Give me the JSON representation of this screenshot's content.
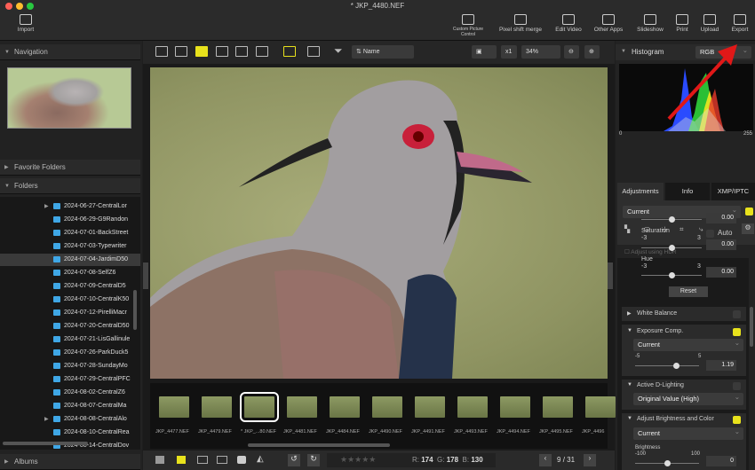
{
  "window": {
    "title": "* JKP_4480.NEF"
  },
  "toolbar": {
    "import": "Import",
    "custom_picture_control": "Custom Picture Control",
    "pixel_shift_merge": "Pixel shift merge",
    "edit_video": "Edit Video",
    "other_apps": "Other Apps",
    "slideshow": "Slideshow",
    "print": "Print",
    "upload": "Upload",
    "export": "Export"
  },
  "left": {
    "navigation": "Navigation",
    "favorite_folders": "Favorite Folders",
    "folders": "Folders",
    "albums": "Albums",
    "folder_items": [
      "2024-06-27-CentralLor",
      "2024-06-29-G9Randon",
      "2024-07-01-BackStreet",
      "2024-07-03-Typewriter",
      "2024-07-04-JardimD50",
      "2024-07-08-SelfZ6",
      "2024-07-09-CentralD5",
      "2024-07-10-CentralK50",
      "2024-07-12-PirelliMacr",
      "2024-07-20-CentralD50",
      "2024-07-21-LisGallinule",
      "2024-07-26-ParkDuck5",
      "2024-07-28-SundayMo",
      "2024-07-29-CentralPFC",
      "2024-08-02-CentralZ6",
      "2024-08-07-CentralMa",
      "2024-08-08-CentralAlo",
      "2024-08-10-CentralRea",
      "2024-08-14-CentralDov"
    ]
  },
  "viewer": {
    "sort": "Name",
    "magnification": "x1",
    "zoom": "34%"
  },
  "filmstrip": [
    "JKP_4477.NEF",
    "JKP_4479.NEF",
    "* JKP_...80.NEF",
    "JKP_4481.NEF",
    "JKP_4484.NEF",
    "JKP_4490.NEF",
    "JKP_4491.NEF",
    "JKP_4493.NEF",
    "JKP_4494.NEF",
    "JKP_4495.NEF",
    "JKP_4496"
  ],
  "statusbar": {
    "r_label": "R:",
    "r": "174",
    "g_label": "G:",
    "g": "178",
    "b_label": "B:",
    "b": "130",
    "page": "9",
    "sep": "/",
    "total": "31"
  },
  "right": {
    "histogram": "Histogram",
    "channel": "RGB",
    "hist_min": "0",
    "hist_max": "255",
    "tabs": [
      "Adjustments",
      "Info",
      "XMP/IPTC"
    ],
    "preset": "Current",
    "hdr": "Adjust using HDR",
    "top_value": "0.00",
    "saturation": "Saturation",
    "sat_min": "-3",
    "sat_max": "3",
    "sat_value": "0.00",
    "auto": "Auto",
    "hue": "Hue",
    "hue_min": "-3",
    "hue_max": "3",
    "hue_value": "0.00",
    "reset": "Reset",
    "white_balance": "White Balance",
    "exposure": "Exposure Comp.",
    "exposure_preset": "Current",
    "exp_min": "-5",
    "exp_max": "5",
    "exp_value": "1.19",
    "adl": "Active D-Lighting",
    "adl_value": "Original Value (High)",
    "abc": "Adjust Brightness and Color",
    "abc_preset": "Current",
    "brightness": "Brightness",
    "br_min": "-100",
    "br_max": "100",
    "br_value": "0"
  }
}
